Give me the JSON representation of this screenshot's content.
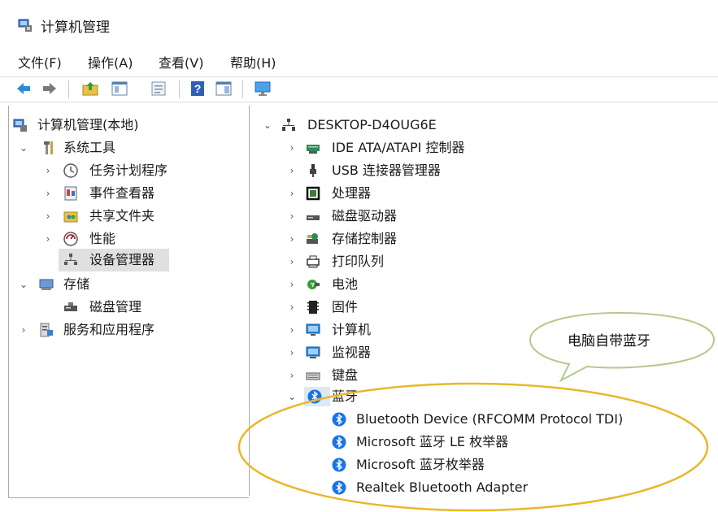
{
  "window": {
    "title": "计算机管理"
  },
  "menu": [
    {
      "label": "文件(F)"
    },
    {
      "label": "操作(A)"
    },
    {
      "label": "查看(V)"
    },
    {
      "label": "帮助(H)"
    }
  ],
  "toolbar": {
    "icons": [
      "back-arrow-icon",
      "forward-arrow-icon",
      "up-folder-icon",
      "show-hide-tree-icon",
      "properties-icon",
      "help-icon",
      "action-pane-icon",
      "monitor-icon"
    ]
  },
  "left_tree": {
    "root": "计算机管理(本地)",
    "system_tools": "系统工具",
    "task_scheduler": "任务计划程序",
    "event_viewer": "事件查看器",
    "shared_folders": "共享文件夹",
    "performance": "性能",
    "device_manager": "设备管理器",
    "storage": "存储",
    "disk_management": "磁盘管理",
    "services_apps": "服务和应用程序"
  },
  "device_tree": {
    "computer": "DESKTOP-D4OUG6E",
    "categories": [
      {
        "label": "IDE ATA/ATAPI 控制器",
        "icon": "ide-controller-icon"
      },
      {
        "label": "USB 连接器管理器",
        "icon": "usb-icon"
      },
      {
        "label": "处理器",
        "icon": "processor-icon"
      },
      {
        "label": "磁盘驱动器",
        "icon": "disk-drive-icon"
      },
      {
        "label": "存储控制器",
        "icon": "storage-controller-icon"
      },
      {
        "label": "打印队列",
        "icon": "printer-icon"
      },
      {
        "label": "电池",
        "icon": "battery-icon"
      },
      {
        "label": "固件",
        "icon": "firmware-icon"
      },
      {
        "label": "计算机",
        "icon": "computer-icon"
      },
      {
        "label": "监视器",
        "icon": "monitor-icon"
      },
      {
        "label": "键盘",
        "icon": "keyboard-icon"
      }
    ],
    "bluetooth": {
      "label": "蓝牙",
      "devices": [
        {
          "label": "Bluetooth Device (RFCOMM Protocol TDI)"
        },
        {
          "label": "Microsoft 蓝牙 LE 枚举器"
        },
        {
          "label": "Microsoft 蓝牙枚举器"
        },
        {
          "label": "Realtek Bluetooth Adapter"
        }
      ]
    }
  },
  "annotation": {
    "text": "电脑自带蓝牙",
    "color": "#e8b82a"
  },
  "colors": {
    "bluetooth": "#1a73e8",
    "selection": "#e0e0e0"
  }
}
